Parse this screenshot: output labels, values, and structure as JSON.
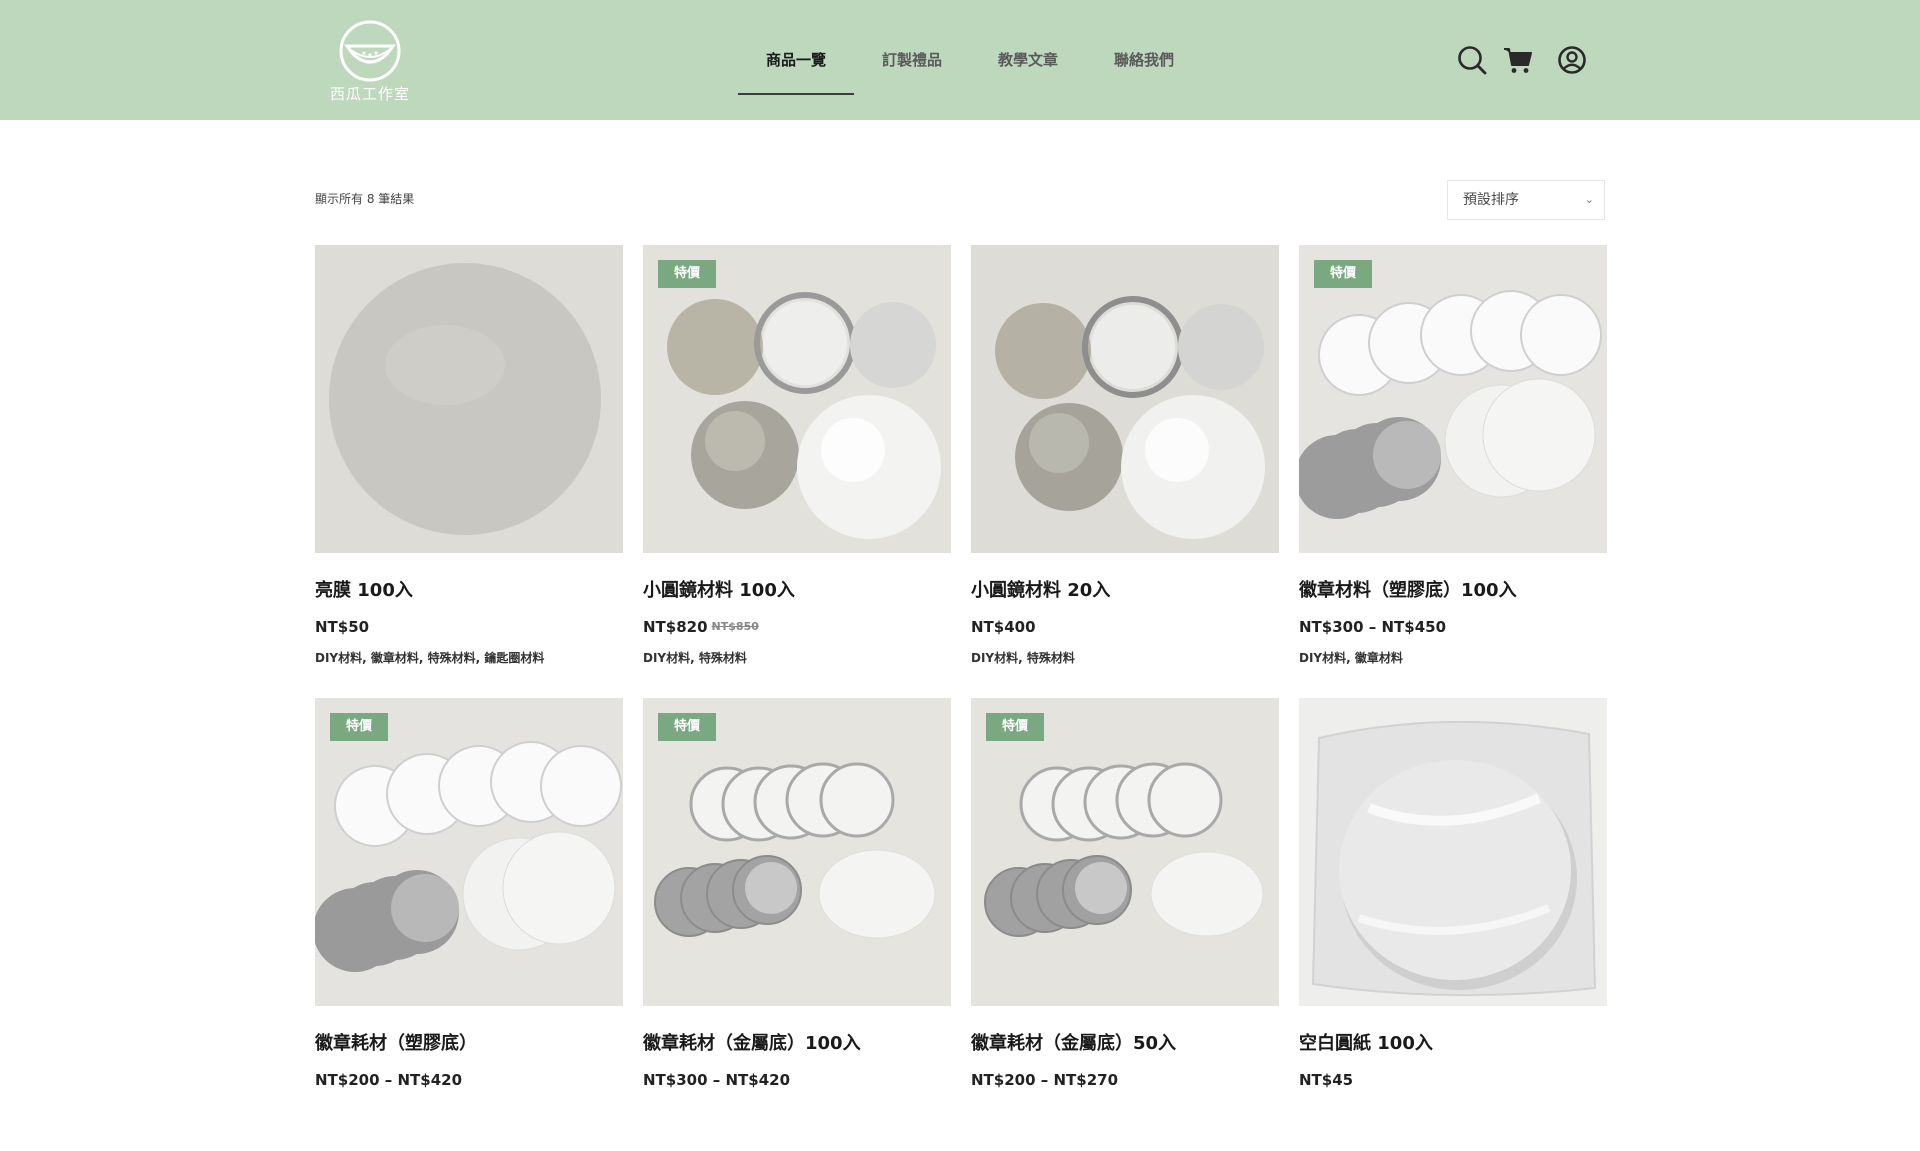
{
  "header": {
    "logo_text": "西瓜工作室",
    "nav": [
      {
        "label": "商品一覽",
        "active": true
      },
      {
        "label": "訂製禮品",
        "active": false
      },
      {
        "label": "教學文章",
        "active": false
      },
      {
        "label": "聯絡我們",
        "active": false
      }
    ],
    "icons": [
      "search-icon",
      "cart-icon",
      "account-icon"
    ],
    "background_color": "#bed8be"
  },
  "shop": {
    "result_count": "顯示所有 8 筆結果",
    "sort_selected": "預設排序"
  },
  "badge_color": "#7aa881",
  "products": [
    {
      "title": "亮膜 100入",
      "price": "NT$50",
      "old_price": "",
      "badge": "",
      "categories": [
        "DIY材料",
        "徽章材料",
        "特殊材料",
        "鑰匙圈材料"
      ]
    },
    {
      "title": "小圓鏡材料 100入",
      "price": "NT$820",
      "old_price": "NT$850",
      "badge": "特價",
      "categories": [
        "DIY材料",
        "特殊材料"
      ]
    },
    {
      "title": "小圓鏡材料 20入",
      "price": "NT$400",
      "old_price": "",
      "badge": "",
      "categories": [
        "DIY材料",
        "特殊材料"
      ]
    },
    {
      "title": "徽章材料（塑膠底）100入",
      "price": "NT$300 – NT$450",
      "old_price": "",
      "badge": "特價",
      "categories": [
        "DIY材料",
        "徽章材料"
      ]
    },
    {
      "title": "徽章耗材（塑膠底）",
      "price": "NT$200 – NT$420",
      "old_price": "",
      "badge": "特價",
      "categories": []
    },
    {
      "title": "徽章耗材（金屬底）100入",
      "price": "NT$300 – NT$420",
      "old_price": "",
      "badge": "特價",
      "categories": []
    },
    {
      "title": "徽章耗材（金屬底）50入",
      "price": "NT$200 – NT$270",
      "old_price": "",
      "badge": "特價",
      "categories": []
    },
    {
      "title": "空白圓紙 100入",
      "price": "NT$45",
      "old_price": "",
      "badge": "",
      "categories": []
    }
  ]
}
